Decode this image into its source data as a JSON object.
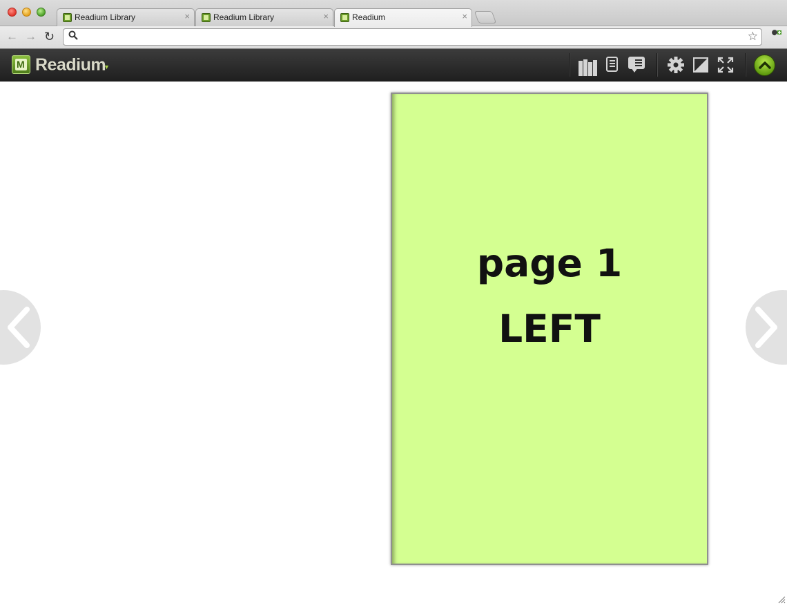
{
  "browser": {
    "tabs": [
      {
        "title": "Readium Library",
        "active": false
      },
      {
        "title": "Readium Library",
        "active": false
      },
      {
        "title": "Readium",
        "active": true
      }
    ],
    "close_glyph": "×",
    "address": {
      "value": "",
      "placeholder": ""
    },
    "icons": {
      "back": "arrow-left-icon",
      "forward": "arrow-right-icon",
      "reload": "reload-icon",
      "search": "search-icon",
      "bookmark": "star-icon",
      "menu": "wrench-icon"
    }
  },
  "toolbar": {
    "logo_text": "Readium",
    "icons": [
      "library-icon",
      "toc-icon",
      "notes-icon",
      "gear-icon",
      "contrast-icon",
      "fullscreen-icon",
      "chevron-up-icon"
    ],
    "accent_color": "#8cc63f"
  },
  "reader": {
    "page_background": "#d4ff91",
    "page_lines": [
      "page 1",
      "LEFT"
    ]
  }
}
